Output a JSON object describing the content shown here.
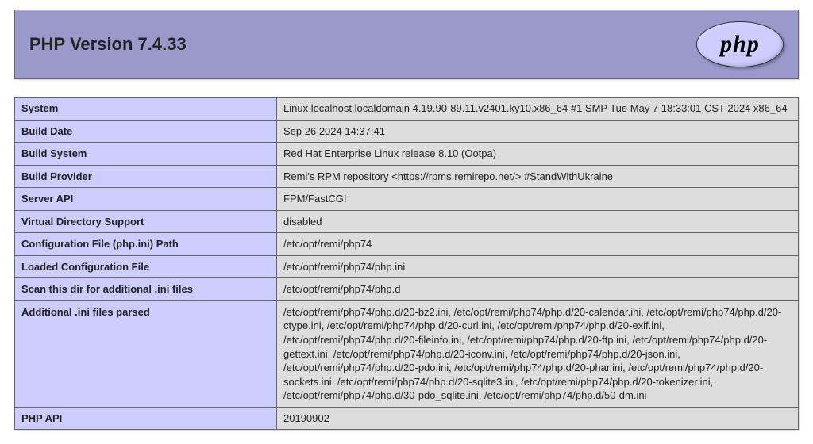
{
  "header": {
    "title": "PHP Version 7.4.33",
    "logo_text": "php"
  },
  "rows": [
    {
      "key": "System",
      "value": "Linux localhost.localdomain 4.19.90-89.11.v2401.ky10.x86_64 #1 SMP Tue May 7 18:33:01 CST 2024 x86_64"
    },
    {
      "key": "Build Date",
      "value": "Sep 26 2024 14:37:41"
    },
    {
      "key": "Build System",
      "value": "Red Hat Enterprise Linux release 8.10 (Ootpa)"
    },
    {
      "key": "Build Provider",
      "value": "Remi's RPM repository <https://rpms.remirepo.net/> #StandWithUkraine"
    },
    {
      "key": "Server API",
      "value": "FPM/FastCGI"
    },
    {
      "key": "Virtual Directory Support",
      "value": "disabled"
    },
    {
      "key": "Configuration File (php.ini) Path",
      "value": "/etc/opt/remi/php74"
    },
    {
      "key": "Loaded Configuration File",
      "value": "/etc/opt/remi/php74/php.ini"
    },
    {
      "key": "Scan this dir for additional .ini files",
      "value": "/etc/opt/remi/php74/php.d"
    },
    {
      "key": "Additional .ini files parsed",
      "value": "/etc/opt/remi/php74/php.d/20-bz2.ini, /etc/opt/remi/php74/php.d/20-calendar.ini, /etc/opt/remi/php74/php.d/20-ctype.ini, /etc/opt/remi/php74/php.d/20-curl.ini, /etc/opt/remi/php74/php.d/20-exif.ini, /etc/opt/remi/php74/php.d/20-fileinfo.ini, /etc/opt/remi/php74/php.d/20-ftp.ini, /etc/opt/remi/php74/php.d/20-gettext.ini, /etc/opt/remi/php74/php.d/20-iconv.ini, /etc/opt/remi/php74/php.d/20-json.ini, /etc/opt/remi/php74/php.d/20-pdo.ini, /etc/opt/remi/php74/php.d/20-phar.ini, /etc/opt/remi/php74/php.d/20-sockets.ini, /etc/opt/remi/php74/php.d/20-sqlite3.ini, /etc/opt/remi/php74/php.d/20-tokenizer.ini, /etc/opt/remi/php74/php.d/30-pdo_sqlite.ini, /etc/opt/remi/php74/php.d/50-dm.ini"
    },
    {
      "key": "PHP API",
      "value": "20190902"
    }
  ]
}
